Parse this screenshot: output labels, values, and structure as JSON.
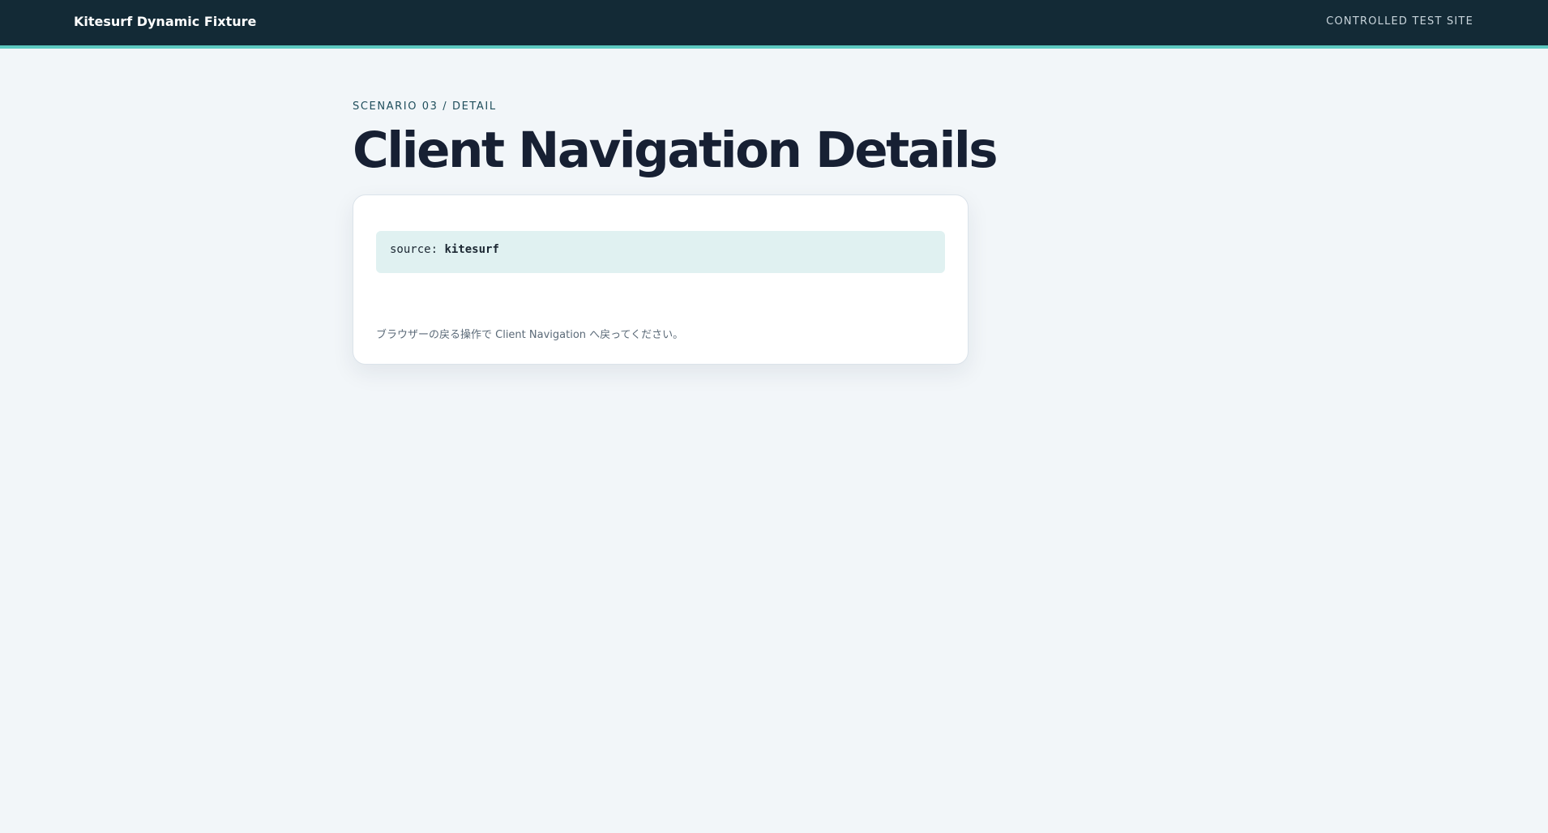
{
  "header": {
    "brand": "Kitesurf Dynamic Fixture",
    "site_tag": "CONTROLLED TEST SITE"
  },
  "main": {
    "eyebrow": "SCENARIO 03 / DETAIL",
    "title": "Client Navigation Details",
    "card": {
      "source_label": "source: ",
      "source_value": "kitesurf",
      "hint": "ブラウザーの戻る操作で Client Navigation へ戻ってください。"
    }
  },
  "colors": {
    "topbar": "#132a36",
    "accent": "#5cc8c0",
    "page_background": "#f2f6f9",
    "code_background": "#e0f1f1",
    "title_text": "#172033"
  }
}
